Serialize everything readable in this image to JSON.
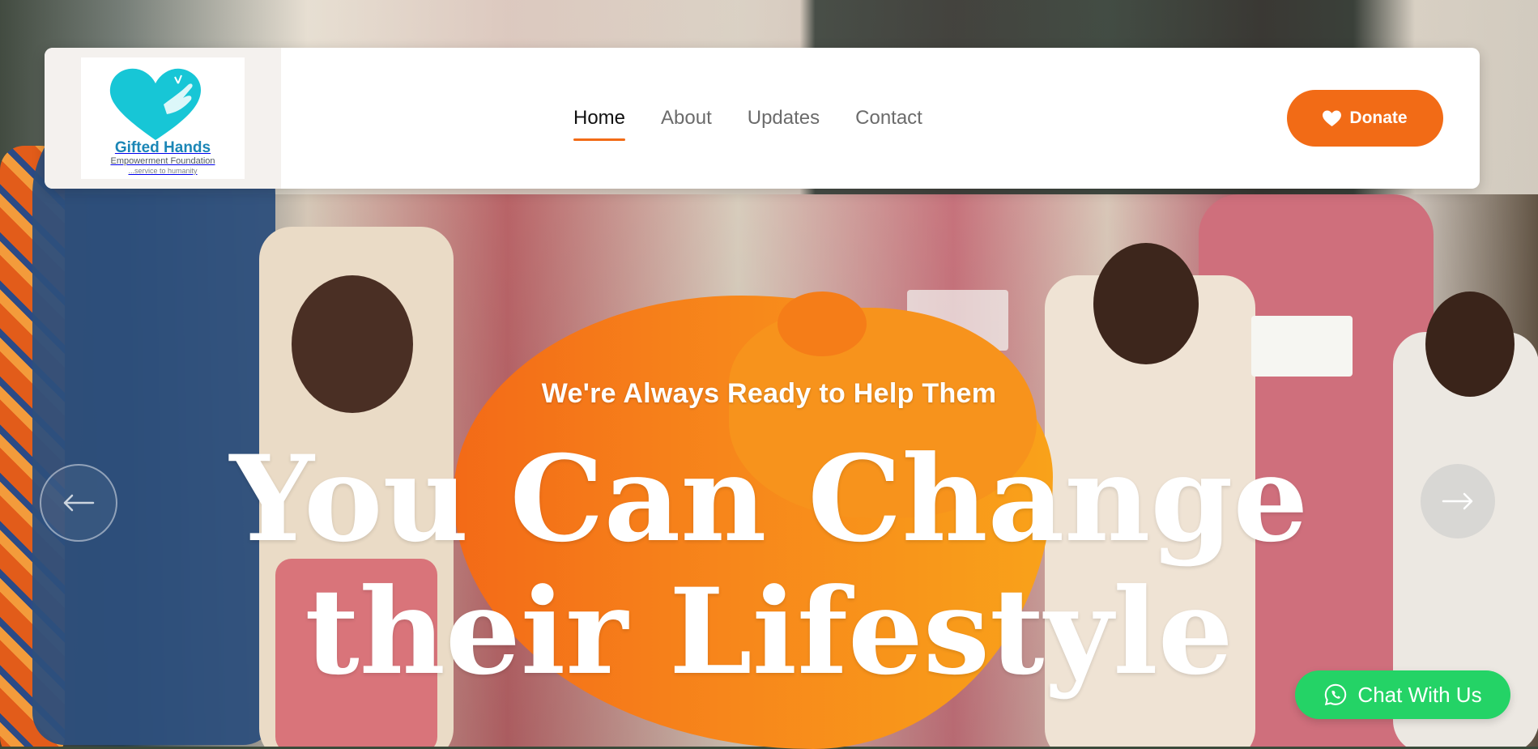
{
  "brand": {
    "name": "Gifted Hands",
    "subtitle": "Empowerment Foundation",
    "tagline": "...service to humanity",
    "colors": {
      "accent": "#f26b16",
      "logo_blue": "#1b86b6",
      "logo_teal": "#17c6d6",
      "chat_green": "#24d366"
    }
  },
  "nav": {
    "items": [
      {
        "label": "Home",
        "active": true
      },
      {
        "label": "About",
        "active": false
      },
      {
        "label": "Updates",
        "active": false
      },
      {
        "label": "Contact",
        "active": false
      }
    ],
    "donate_label": "Donate",
    "donate_icon": "heart-icon"
  },
  "hero": {
    "kicker": "We're Always Ready to Help Them",
    "headline_line1": "You Can Change",
    "headline_line2": "their Lifestyle",
    "prev_icon": "arrow-left-icon",
    "next_icon": "arrow-right-icon"
  },
  "chat": {
    "label": "Chat With Us",
    "icon": "whatsapp-icon"
  }
}
